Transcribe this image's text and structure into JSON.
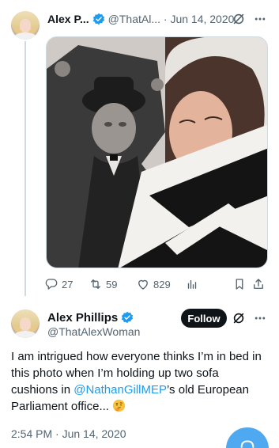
{
  "tweet1": {
    "name": "Alex P...",
    "handle_date": "@ThatAl... · Jun 14, 2020",
    "stats": {
      "replies": "27",
      "retweets": "59",
      "likes": "829"
    }
  },
  "tweet2": {
    "name": "Alex Phillips",
    "handle": "@ThatAlexWoman",
    "follow_label": "Follow",
    "text_part1": "I am intrigued how everyone thinks I’m in bed in this photo when I’m holding up two sofa cushions in ",
    "mention": "@NathanGillMEP",
    "text_part2": "’s old European Parliament office...",
    "timestamp": "2:54 PM · Jun 14, 2020"
  },
  "colors": {
    "accent": "#1d9bf0",
    "text": "#0f1419",
    "muted": "#536471"
  },
  "icons": {
    "verified": "verified-badge-icon",
    "grok": "grok-icon",
    "more": "more-icon",
    "reply": "reply-icon",
    "retweet": "retweet-icon",
    "like": "like-icon",
    "views": "views-icon",
    "bookmark": "bookmark-icon",
    "share": "share-icon",
    "emoji": "thinking-face-emoji",
    "compose": "compose-icon"
  }
}
